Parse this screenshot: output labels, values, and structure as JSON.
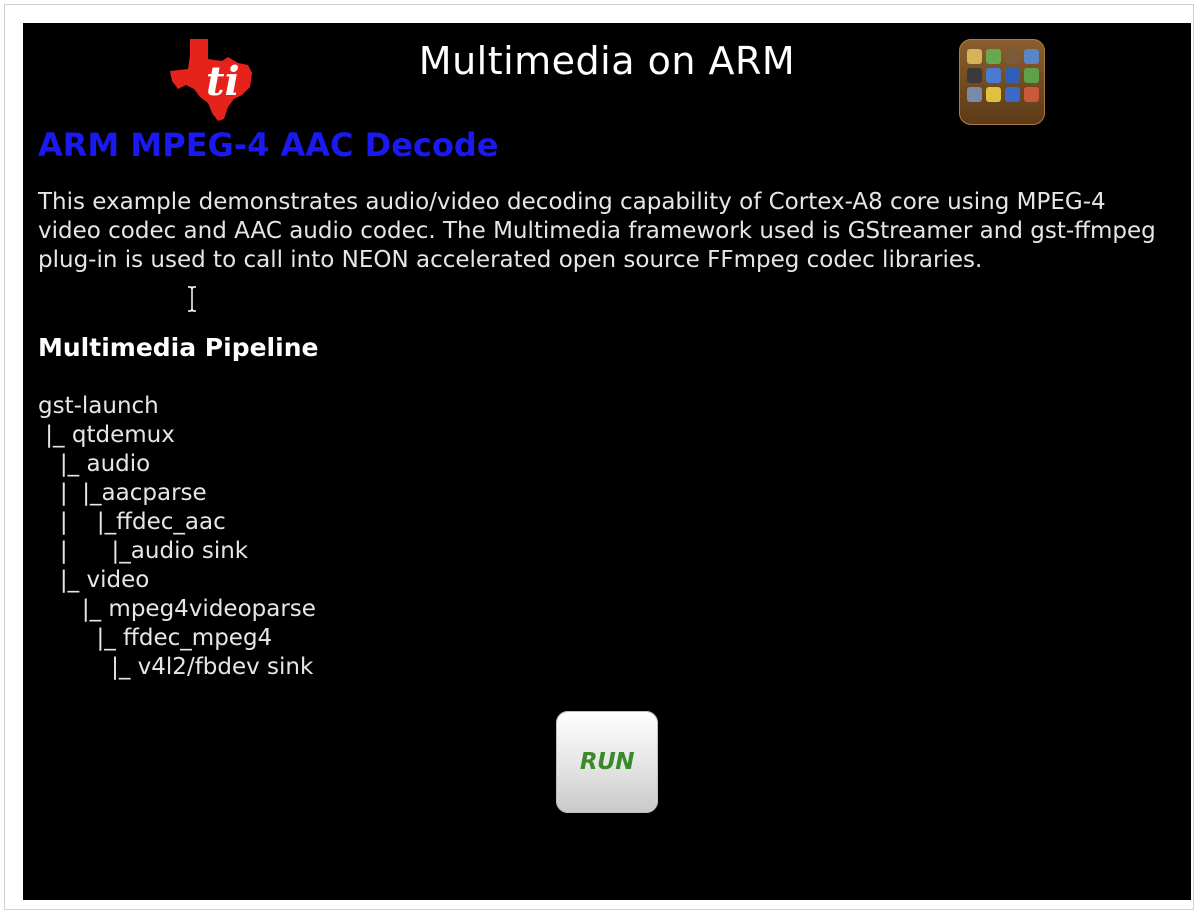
{
  "header": {
    "title": "Multimedia on ARM",
    "logo_icon": "ti-texas-logo-icon",
    "apps_icon": "app-grid-icon",
    "logo_color": "#e5231b"
  },
  "content": {
    "heading": "ARM MPEG-4 AAC Decode",
    "heading_color": "#1a1af0",
    "description": "This example demonstrates audio/video decoding capability of Cortex-A8 core using MPEG-4 video codec and AAC audio codec. The Multimedia framework used is GStreamer and gst-ffmpeg plug-in is used to call into NEON accelerated open source FFmpeg codec libraries.",
    "pipeline_title": "Multimedia Pipeline",
    "pipeline_lines": [
      "gst-launch",
      " |_ qtdemux",
      "   |_ audio",
      "   |  |_aacparse",
      "   |    |_ffdec_aac",
      "   |      |_audio sink",
      "   |_ video",
      "      |_ mpeg4videoparse",
      "        |_ ffdec_mpeg4",
      "          |_ v4l2/fbdev sink"
    ]
  },
  "run_button": {
    "label": "RUN",
    "label_color": "#3a8a2a"
  },
  "cursor": {
    "icon": "text-cursor-icon"
  }
}
